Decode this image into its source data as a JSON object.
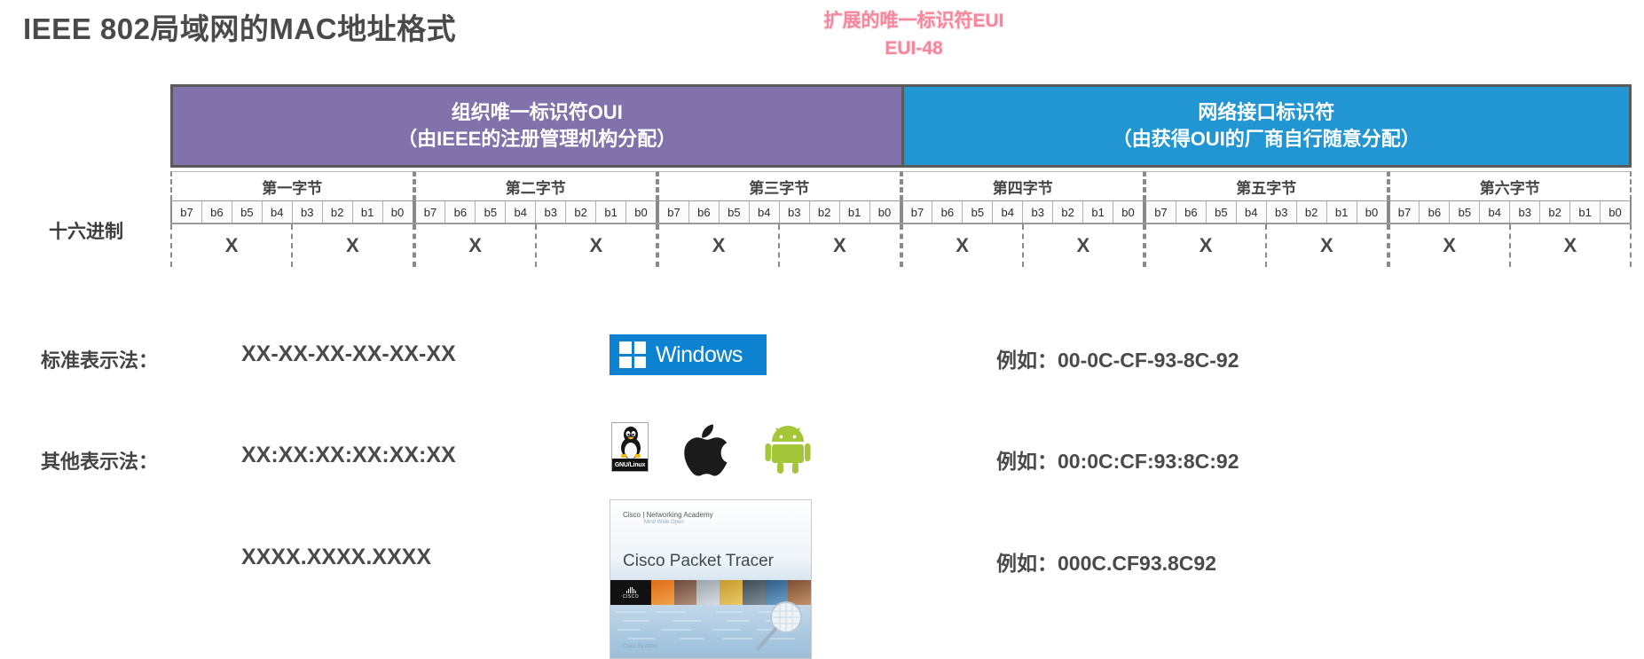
{
  "page_title": "IEEE 802局域网的MAC地址格式",
  "eui_callout": {
    "line1": "扩展的唯一标识符EUI",
    "line2": "EUI-48",
    "color": "#f4879c"
  },
  "diagram": {
    "bands": [
      {
        "name": "oui",
        "line1": "组织唯一标识符OUI",
        "line2": "（由IEEE的注册管理机构分配）",
        "color": "#8272ab"
      },
      {
        "name": "nic",
        "line1": "网络接口标识符",
        "line2": "（由获得OUI的厂商自行随意分配）",
        "color": "#2196d3"
      }
    ],
    "bytes": [
      "第一字节",
      "第二字节",
      "第三字节",
      "第四字节",
      "第五字节",
      "第六字节"
    ],
    "bits": [
      "b7",
      "b6",
      "b5",
      "b4",
      "b3",
      "b2",
      "b1",
      "b0"
    ],
    "hex_label": "十六进制",
    "hex_marker": "X",
    "hex_markers_per_byte": 2
  },
  "notations": [
    {
      "label": "标准表示法：",
      "value": "XX-XX-XX-XX-XX-XX",
      "example": "例如：00-0C-CF-93-8C-92"
    },
    {
      "label": "其他表示法：",
      "value": "XX:XX:XX:XX:XX:XX",
      "example": "例如：00:0C:CF:93:8C:92"
    },
    {
      "label": "",
      "value": "XXXX.XXXX.XXXX",
      "example": "例如：000C.CF93.8C92"
    }
  ],
  "logos": {
    "windows": {
      "wordmark": "Windows",
      "background": "#0c82d1"
    },
    "linux": {
      "badge": "GNU/Linux"
    },
    "apple": {
      "name": "apple-logo"
    },
    "android": {
      "name": "android-logo",
      "color": "#a4c639"
    },
    "packet_tracer": {
      "academy": "Cisco | Networking Academy",
      "tagline": "Mind Wide Open",
      "title": "Cisco Packet Tracer",
      "cisco_wordmark": "CISCO",
      "footer": "Cisco Systems"
    }
  },
  "watermark": {
    "name": "bilibili-tv-play-watermark"
  }
}
